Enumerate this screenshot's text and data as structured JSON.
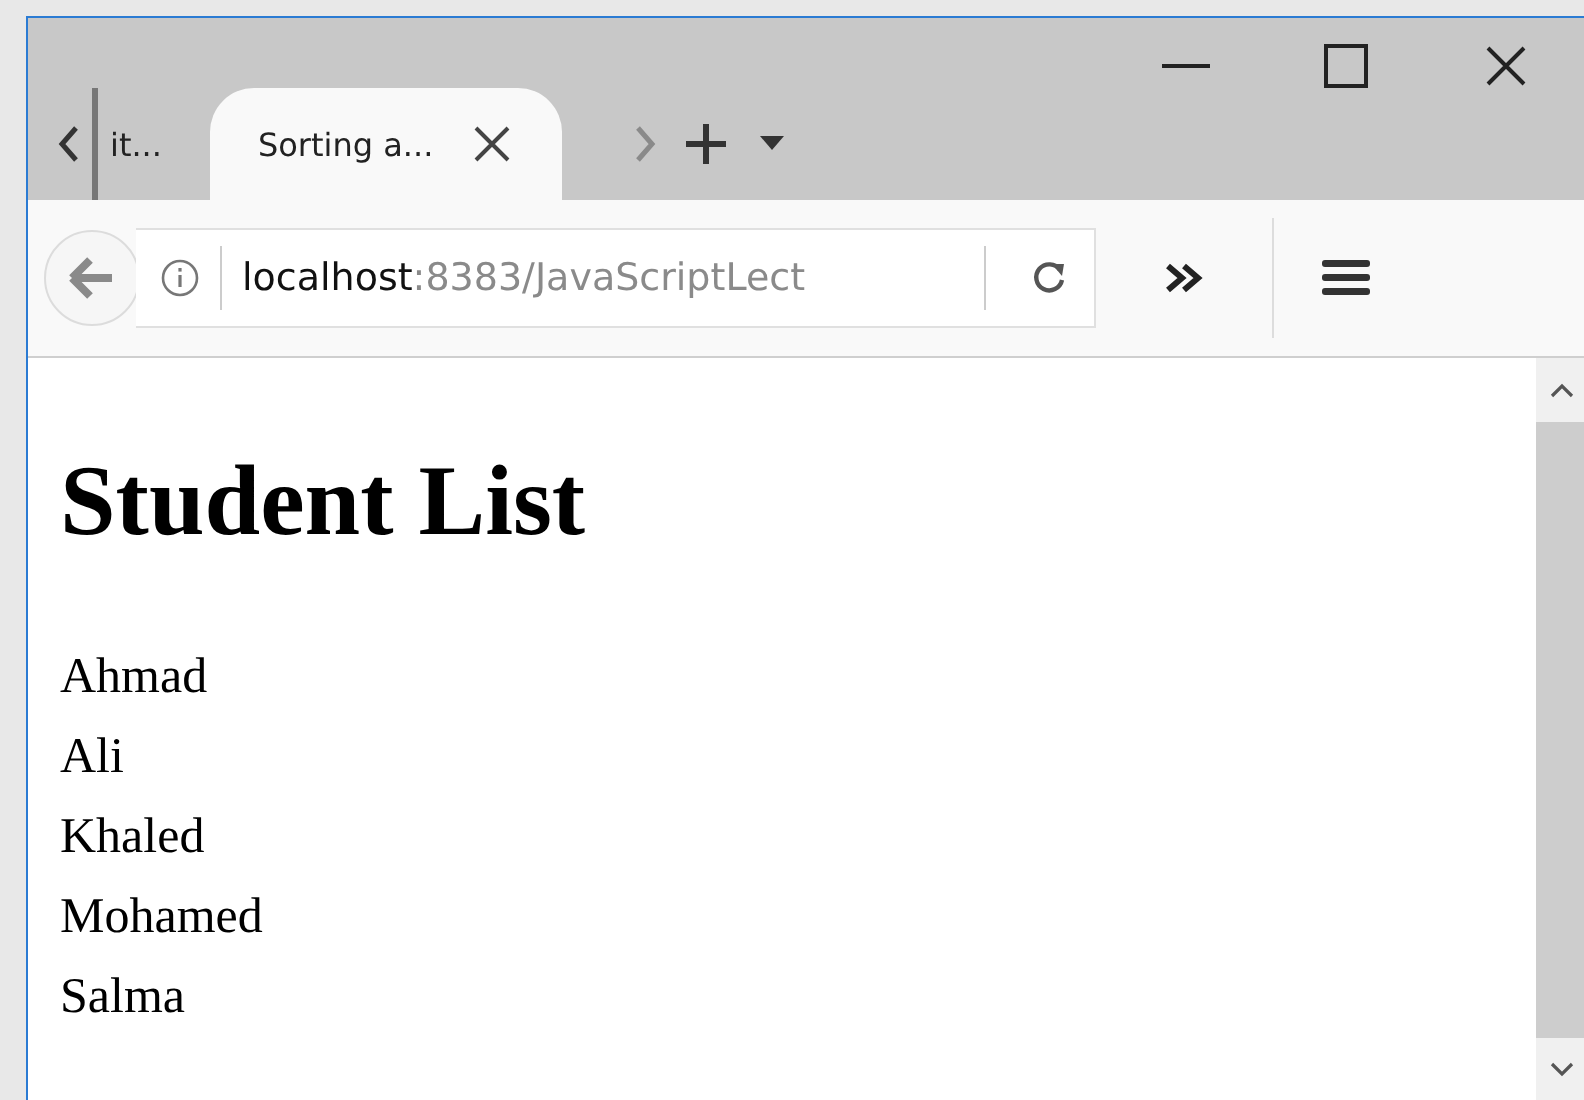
{
  "tabs": [
    {
      "label": "it...",
      "selected": false
    },
    {
      "label": "Sorting a...",
      "selected": true
    }
  ],
  "address_bar": {
    "host": "localhost",
    "path": ":8383/JavaScriptLect"
  },
  "page": {
    "heading": "Student List",
    "students": [
      "Ahmad",
      "Ali",
      "Khaled",
      "Mohamed",
      "Salma"
    ]
  }
}
